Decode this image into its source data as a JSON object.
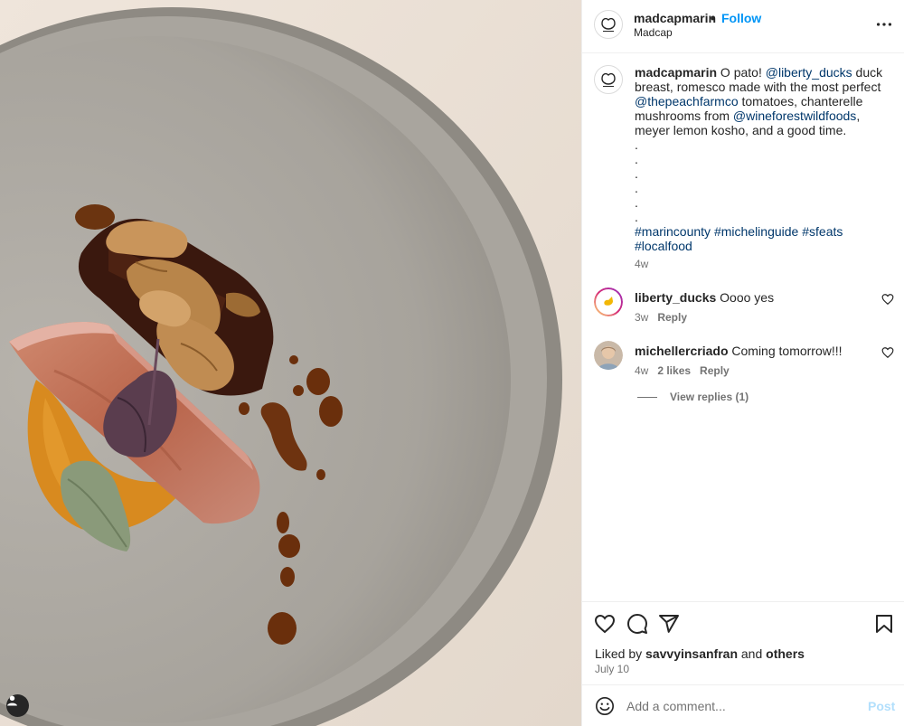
{
  "post": {
    "username": "madcapmarin",
    "separator": "•",
    "follow_label": "Follow",
    "location": "Madcap",
    "more_options_icon": "ellipsis-icon",
    "user_tag_icon": "user-tag-icon"
  },
  "caption": {
    "username": "madcapmarin",
    "text_1": " O pato! ",
    "mention_1": "@liberty_ducks",
    "text_2": " duck breast, romesco made with the most perfect ",
    "mention_2": "@thepeachfarmco",
    "text_3": " tomatoes, chanterelle mushrooms from ",
    "mention_3": "@wineforestwildfoods",
    "text_4": ", meyer lemon kosho, and a good time.",
    "dots": [
      ".",
      ".",
      ".",
      ".",
      ".",
      "."
    ],
    "hashtag_1": "#marincounty",
    "hashtag_2": "#michelinguide",
    "hashtag_3": "#sfeats",
    "hashtag_4": "#localfood",
    "time": "4w"
  },
  "comments": [
    {
      "username": "liberty_ducks",
      "text": "Oooo yes",
      "time": "3w",
      "likes": "",
      "reply_label": "Reply"
    },
    {
      "username": "michellercriado",
      "text": "Coming tomorrow!!!",
      "time": "4w",
      "likes": "2 likes",
      "reply_label": "Reply"
    }
  ],
  "view_replies_label": "View replies (1)",
  "actions": {
    "like_icon": "heart-icon",
    "comment_icon": "comment-icon",
    "share_icon": "send-icon",
    "save_icon": "bookmark-icon"
  },
  "likes": {
    "prefix": "Liked by ",
    "user": "savvyinsanfran",
    "joiner": " and ",
    "others": "others"
  },
  "date": "July 10",
  "add_comment": {
    "placeholder": "Add a comment...",
    "post_label": "Post",
    "emoji_icon": "emoji-icon"
  },
  "colors": {
    "accent": "#0095f6",
    "mention": "#00376b",
    "muted": "#737373",
    "post_disabled": "#b2dffc"
  }
}
